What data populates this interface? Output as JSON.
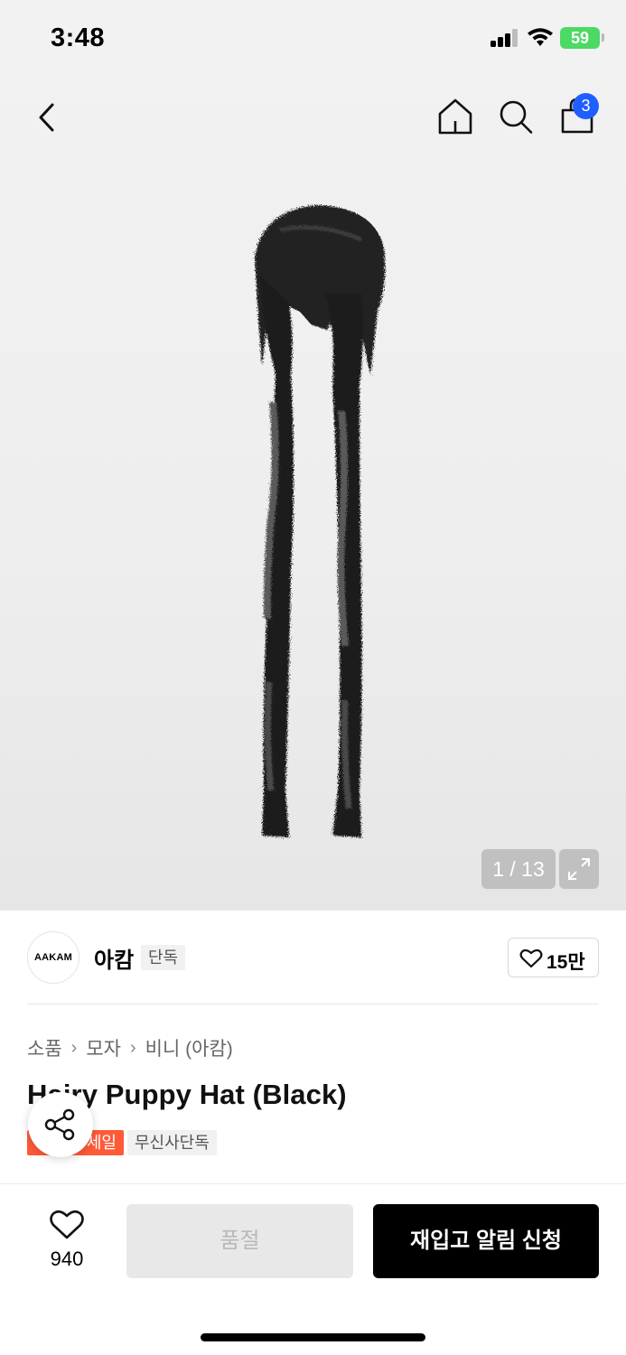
{
  "status_bar": {
    "time": "3:48",
    "battery": "59"
  },
  "nav": {
    "cart_count": "3"
  },
  "gallery": {
    "counter": "1 / 13"
  },
  "brand": {
    "logo_text": "AAKAM",
    "name": "아캄",
    "tag": "단독",
    "likes": "15만"
  },
  "breadcrumb": {
    "items": [
      "소품",
      "모자",
      "비니 (아캄)"
    ]
  },
  "product": {
    "title": "Hairy Puppy Hat (Black)",
    "tags": {
      "sale": "세일",
      "exclusive": "무신사단독"
    }
  },
  "bottom_bar": {
    "wish_count": "940",
    "soldout_label": "품절",
    "restock_label": "재입고 알림 신청"
  },
  "colors": {
    "accent_badge": "#1f5eff",
    "sale_tag": "#ff5a37",
    "battery": "#4cd964"
  },
  "icons": [
    "back-icon",
    "home-icon",
    "search-icon",
    "bag-icon",
    "expand-icon",
    "heart-icon",
    "share-icon"
  ]
}
